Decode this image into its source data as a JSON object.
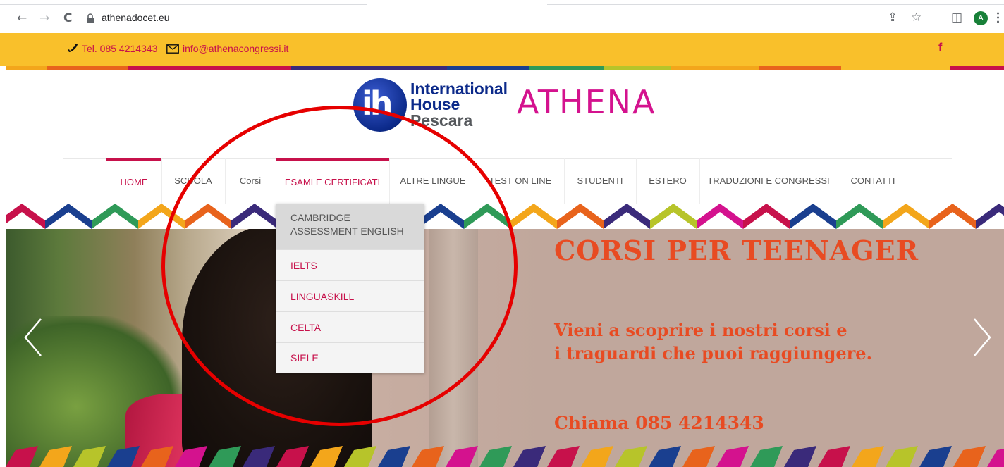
{
  "browser": {
    "url": "athenadocet.eu",
    "back_icon": "←",
    "forward_icon": "→",
    "reload_icon": "C",
    "share_icon": "⇪",
    "star_icon": "☆",
    "sidepanel_icon": "◫",
    "avatar_letter": "A"
  },
  "topbar": {
    "phone": "Tel. 085 4214343",
    "email": "info@athenacongressi.it",
    "facebook": "f",
    "background": "#f9c02b",
    "accent": "#c7114b"
  },
  "logo": {
    "line1": "International",
    "line2": "House",
    "line3": "Pescara",
    "mark": "ih",
    "brand": "ATHENA"
  },
  "nav": {
    "items": [
      {
        "label": "HOME"
      },
      {
        "label": "SCUOLA"
      },
      {
        "label": "Corsi"
      },
      {
        "label": "ESAMI E CERTIFICATI"
      },
      {
        "label": "ALTRE LINGUE"
      },
      {
        "label": "TEST ON LINE"
      },
      {
        "label": "STUDENTI"
      },
      {
        "label": "ESTERO"
      },
      {
        "label": "TRADUZIONI E CONGRESSI"
      },
      {
        "label": "CONTATTI"
      }
    ]
  },
  "dropdown": {
    "items": [
      {
        "line1": "CAMBRIDGE",
        "line2": "ASSESSMENT ENGLISH"
      },
      {
        "label": "IELTS"
      },
      {
        "label": "LINGUASKILL"
      },
      {
        "label": "CELTA"
      },
      {
        "label": "SIELE"
      }
    ]
  },
  "hero": {
    "title": "CORSI PER TEENAGER",
    "subtitle_line1": "Vieni a scoprire i nostri corsi e",
    "subtitle_line2": "i traguardi che puoi raggiungere.",
    "call": "Chiama 085 4214343",
    "text_color": "#e84b22"
  }
}
